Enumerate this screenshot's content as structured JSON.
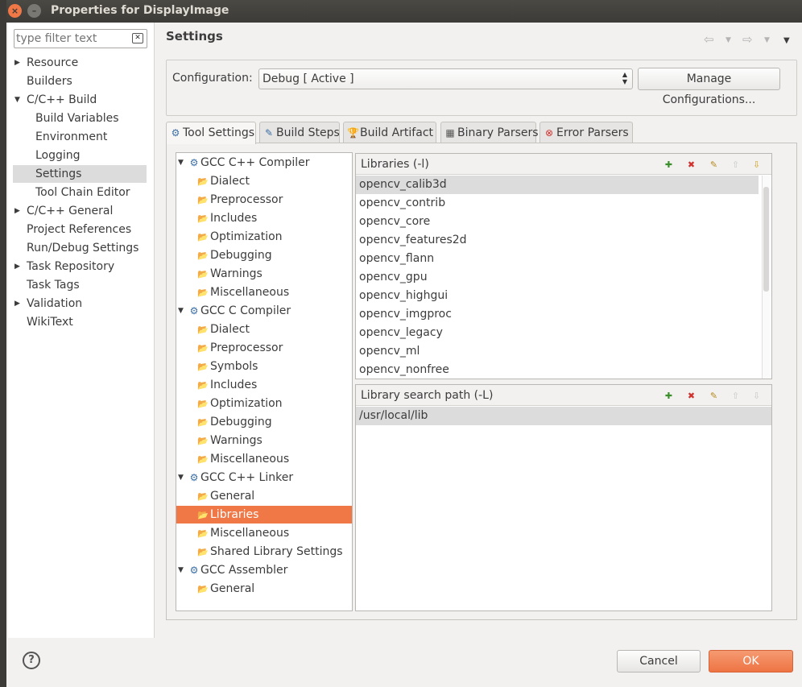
{
  "window": {
    "title": "Properties for DisplayImage"
  },
  "filter": {
    "placeholder": "type filter text"
  },
  "nav": [
    {
      "label": "Resource",
      "expandable": true
    },
    {
      "label": "Builders"
    },
    {
      "label": "C/C++ Build",
      "expanded": true
    },
    {
      "label": "Build Variables"
    },
    {
      "label": "Environment"
    },
    {
      "label": "Logging"
    },
    {
      "label": "Settings",
      "selected": true
    },
    {
      "label": "Tool Chain Editor"
    },
    {
      "label": "C/C++ General",
      "expandable": true
    },
    {
      "label": "Project References"
    },
    {
      "label": "Run/Debug Settings"
    },
    {
      "label": "Task Repository",
      "expandable": true
    },
    {
      "label": "Task Tags"
    },
    {
      "label": "Validation",
      "expandable": true
    },
    {
      "label": "WikiText"
    }
  ],
  "main": {
    "heading": "Settings",
    "config_label": "Configuration:",
    "config_value": "Debug  [ Active ]",
    "manage_button": "Manage Configurations...",
    "tabs": [
      {
        "label": "Tool Settings",
        "active": true
      },
      {
        "label": "Build Steps"
      },
      {
        "label": "Build Artifact"
      },
      {
        "label": "Binary Parsers"
      },
      {
        "label": "Error Parsers"
      }
    ]
  },
  "tree": [
    {
      "label": "GCC C++ Compiler",
      "children": [
        "Dialect",
        "Preprocessor",
        "Includes",
        "Optimization",
        "Debugging",
        "Warnings",
        "Miscellaneous"
      ]
    },
    {
      "label": "GCC C Compiler",
      "children": [
        "Dialect",
        "Preprocessor",
        "Symbols",
        "Includes",
        "Optimization",
        "Debugging",
        "Warnings",
        "Miscellaneous"
      ]
    },
    {
      "label": "GCC C++ Linker",
      "children": [
        "General",
        "Libraries",
        "Miscellaneous",
        "Shared Library Settings"
      ]
    },
    {
      "label": "GCC Assembler",
      "children": [
        "General"
      ]
    }
  ],
  "tree_selected": "Libraries",
  "libraries": {
    "title": "Libraries (-l)",
    "items": [
      "opencv_calib3d",
      "opencv_contrib",
      "opencv_core",
      "opencv_features2d",
      "opencv_flann",
      "opencv_gpu",
      "opencv_highgui",
      "opencv_imgproc",
      "opencv_legacy",
      "opencv_ml",
      "opencv_nonfree"
    ]
  },
  "search_paths": {
    "title": "Library search path (-L)",
    "items": [
      "/usr/local/lib"
    ]
  },
  "footer": {
    "cancel": "Cancel",
    "ok": "OK",
    "help": "?"
  },
  "colors": {
    "accent": "#f07746",
    "selection": "#dcdcdc"
  }
}
